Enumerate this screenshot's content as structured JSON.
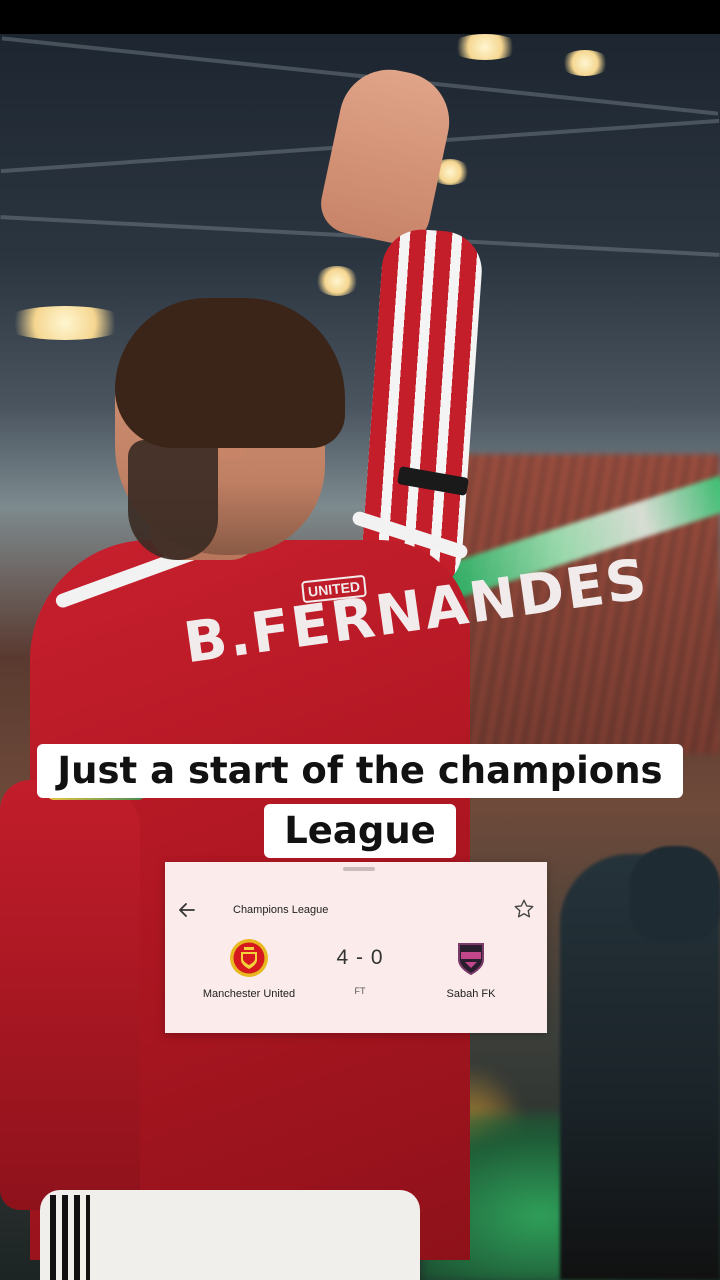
{
  "caption": {
    "line1": "Just a start of the champions",
    "line2": "League"
  },
  "jersey": {
    "name": "B.FERNANDES",
    "brand": "UNITED"
  },
  "match_card": {
    "competition": "Champions League",
    "home_team": "Manchester United",
    "away_team": "Sabah FK",
    "score": "4 - 0",
    "status": "FT",
    "badge_home_text": "MANCHESTER UNITED",
    "badge_away_text": "SABAH",
    "icons": [
      "back-arrow-icon",
      "star-icon"
    ]
  },
  "colors": {
    "card_background": "#fbeceb",
    "jersey_red": "#c41e2b",
    "caption_background": "#ffffff"
  }
}
